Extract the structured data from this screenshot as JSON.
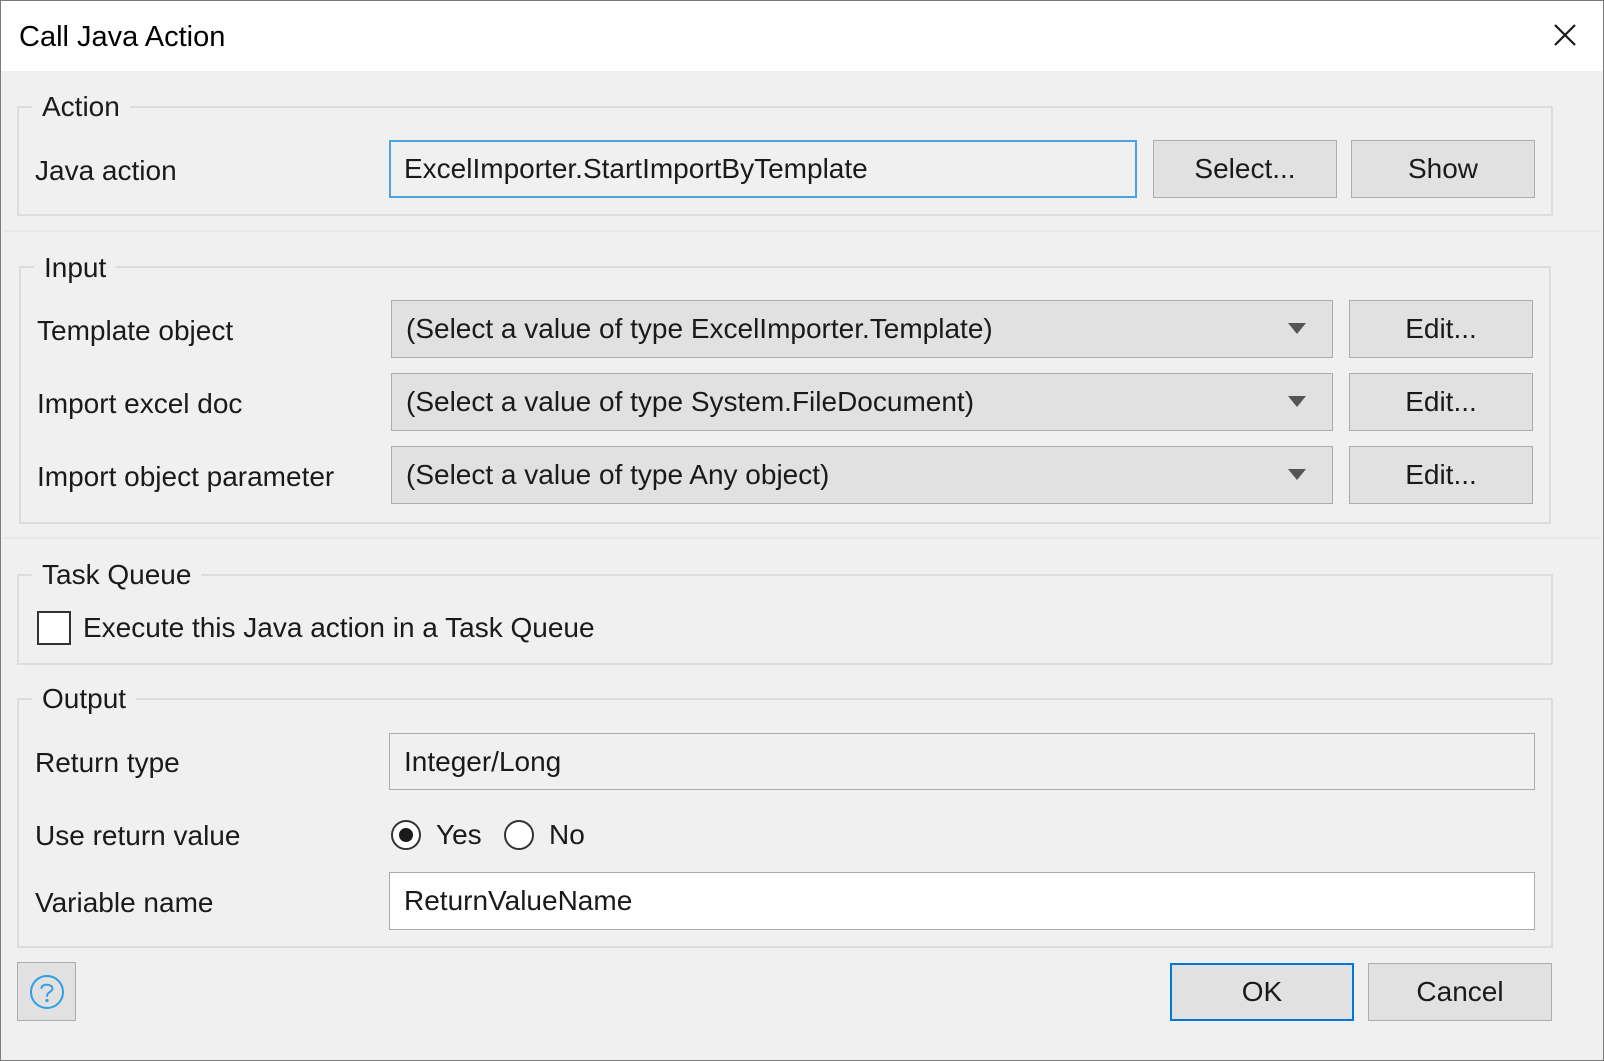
{
  "dialog": {
    "title": "Call Java Action"
  },
  "action_group": {
    "title": "Action",
    "java_action_label": "Java action",
    "java_action_value": "ExcelImporter.StartImportByTemplate",
    "select_button": "Select...",
    "show_button": "Show"
  },
  "input_group": {
    "title": "Input",
    "params": [
      {
        "label": "Template object",
        "value": "(Select a value of type ExcelImporter.Template)",
        "edit": "Edit..."
      },
      {
        "label": "Import excel doc",
        "value": "(Select a value of type System.FileDocument)",
        "edit": "Edit..."
      },
      {
        "label": "Import object parameter",
        "value": "(Select a value of type Any object)",
        "edit": "Edit..."
      }
    ]
  },
  "task_queue_group": {
    "title": "Task Queue",
    "checkbox_label": "Execute this Java action in a Task Queue",
    "checked": false
  },
  "output_group": {
    "title": "Output",
    "return_type_label": "Return type",
    "return_type_value": "Integer/Long",
    "use_return_label": "Use return value",
    "yes_label": "Yes",
    "no_label": "No",
    "use_return_selected": "Yes",
    "variable_name_label": "Variable name",
    "variable_name_value": "ReturnValueName"
  },
  "footer": {
    "ok_button": "OK",
    "cancel_button": "Cancel",
    "help_icon": "question-circle-icon"
  },
  "colors": {
    "accent": "#0078d7",
    "focus_border": "#4aa3df",
    "help_icon": "#2f9ee8"
  }
}
